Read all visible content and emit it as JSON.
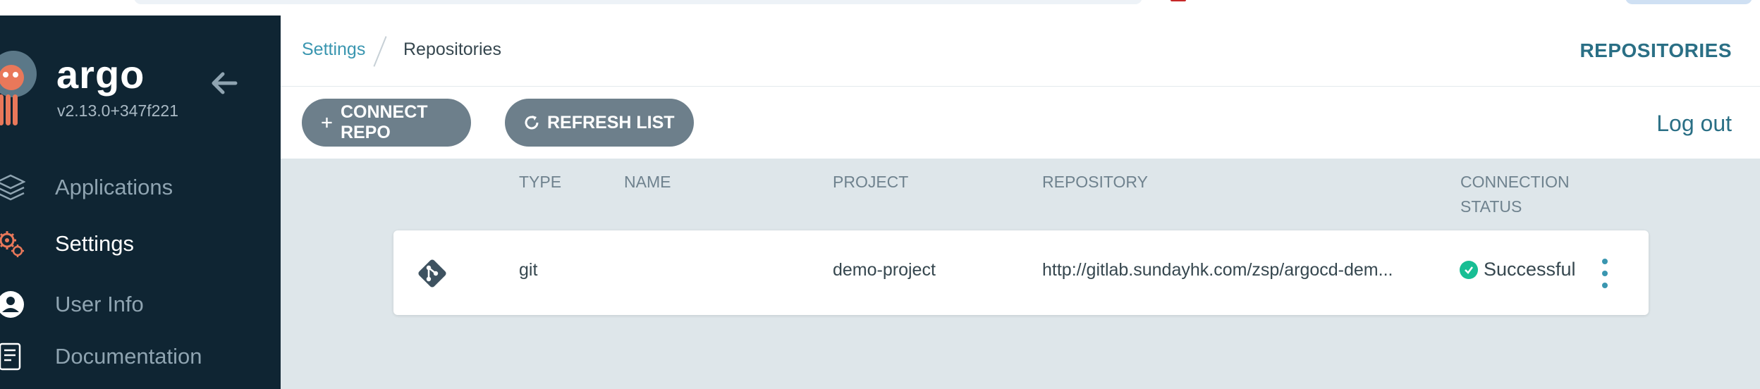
{
  "sidebar": {
    "brand": "argo",
    "version": "v2.13.0+347f221",
    "items": [
      {
        "label": "Applications",
        "icon": "layers-icon",
        "active": false
      },
      {
        "label": "Settings",
        "icon": "gears-icon",
        "active": true
      },
      {
        "label": "User Info",
        "icon": "user-circle-icon",
        "active": false
      },
      {
        "label": "Documentation",
        "icon": "book-icon",
        "active": false
      }
    ]
  },
  "header": {
    "breadcrumb": {
      "parent": "Settings",
      "current": "Repositories"
    },
    "title": "REPOSITORIES"
  },
  "toolbar": {
    "connect_label": "CONNECT REPO",
    "refresh_label": "REFRESH LIST",
    "logout_label": "Log out"
  },
  "table": {
    "headers": {
      "type": "TYPE",
      "name": "NAME",
      "project": "PROJECT",
      "repository": "REPOSITORY",
      "status_line1": "CONNECTION",
      "status_line2": "STATUS"
    },
    "rows": [
      {
        "type": "git",
        "name": "",
        "project": "demo-project",
        "repository": "http://gitlab.sundayhk.com/zsp/argocd-dem...",
        "status": "Successful"
      }
    ]
  },
  "colors": {
    "sidebar_bg": "#0f2533",
    "accent": "#2a6f85",
    "button_bg": "#6d7f8b",
    "success": "#18be94",
    "content_bg": "#dee6ea"
  }
}
